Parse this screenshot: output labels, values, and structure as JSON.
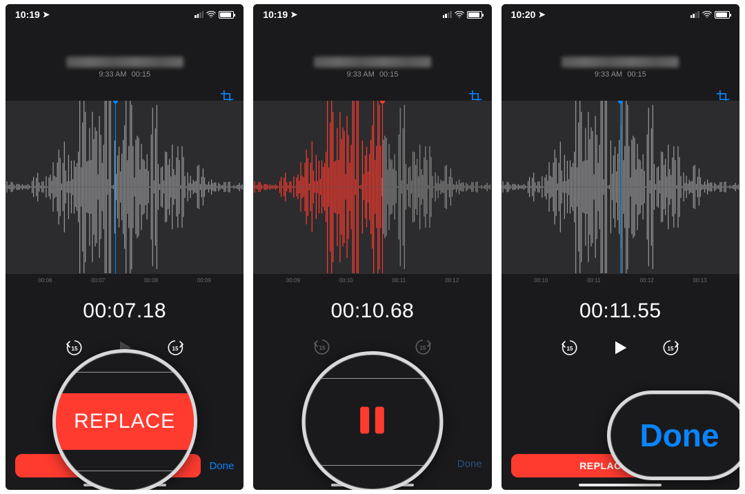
{
  "screens": [
    {
      "status_time": "10:19",
      "title_blurred": true,
      "subtitle_time": "9:33 AM",
      "subtitle_dur": "00:15",
      "playhead_color": "blue",
      "playhead_pct": 46,
      "ruler": [
        "",
        "00:06",
        "",
        "00:07",
        "",
        "00:08",
        "",
        "00:09",
        ""
      ],
      "readout": "00:07.18",
      "transport_mode": "replace",
      "bottom": {
        "replace_label": "REPLACE",
        "done_label": "Done",
        "done_dimmed": false
      },
      "magnifier": {
        "kind": "replace",
        "label": "REPLACE"
      },
      "wave_left_color": "#9a9a9c",
      "wave_right_color": "#9a9a9c"
    },
    {
      "status_time": "10:19",
      "title_blurred": true,
      "subtitle_time": "9:33 AM",
      "subtitle_dur": "00:15",
      "playhead_color": "red",
      "playhead_pct": 54,
      "ruler": [
        "",
        "00:09",
        "",
        "00:10",
        "",
        "00:11",
        "",
        "00:12",
        ""
      ],
      "readout": "00:10.68",
      "transport_mode": "pause",
      "bottom": {
        "replace_label": "",
        "done_label": "Done",
        "done_dimmed": true
      },
      "magnifier": {
        "kind": "pause"
      },
      "wave_left_color": "#ff3b30",
      "wave_right_color": "#888"
    },
    {
      "status_time": "10:20",
      "title_blurred": true,
      "subtitle_time": "9:33 AM",
      "subtitle_dur": "00:15",
      "playhead_color": "blue",
      "playhead_pct": 50,
      "ruler": [
        "",
        "00:10",
        "",
        "00:11",
        "",
        "00:12",
        "",
        "00:13",
        ""
      ],
      "readout": "00:11.55",
      "transport_mode": "play",
      "bottom": {
        "replace_label": "REPLACE",
        "done_label": "Done",
        "done_dimmed": false
      },
      "magnifier": {
        "kind": "done",
        "label": "Done"
      },
      "wave_left_color": "#9a9a9c",
      "wave_right_color": "#9a9a9c"
    }
  ],
  "icons": {
    "skip_back_label": "15",
    "skip_fwd_label": "15"
  }
}
